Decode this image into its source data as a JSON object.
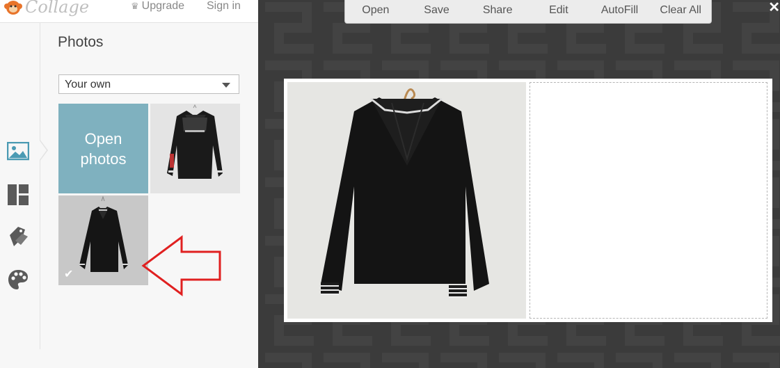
{
  "app": {
    "logo_text": "Collage",
    "upgrade_label": "Upgrade",
    "signin_label": "Sign in"
  },
  "sidebar": {
    "panel_title": "Photos",
    "source_select": {
      "value": "Your own"
    },
    "open_photos_label": "Open photos",
    "rail_icons": [
      "photos-icon",
      "layouts-icon",
      "stickers-icon",
      "backgrounds-icon"
    ],
    "thumbs": [
      {
        "name": "sailor-jacket-photo-1",
        "selected": false
      },
      {
        "name": "sailor-jacket-photo-2",
        "selected": true
      }
    ]
  },
  "toolbar": {
    "open": "Open",
    "save": "Save",
    "share": "Share",
    "edit": "Edit",
    "autofill": "AutoFill",
    "clear_all": "Clear All",
    "close": "✕"
  },
  "colors": {
    "accent": "#7fb1bf",
    "stage": "#3b3b3b",
    "annotation_arrow": "#e02020"
  }
}
